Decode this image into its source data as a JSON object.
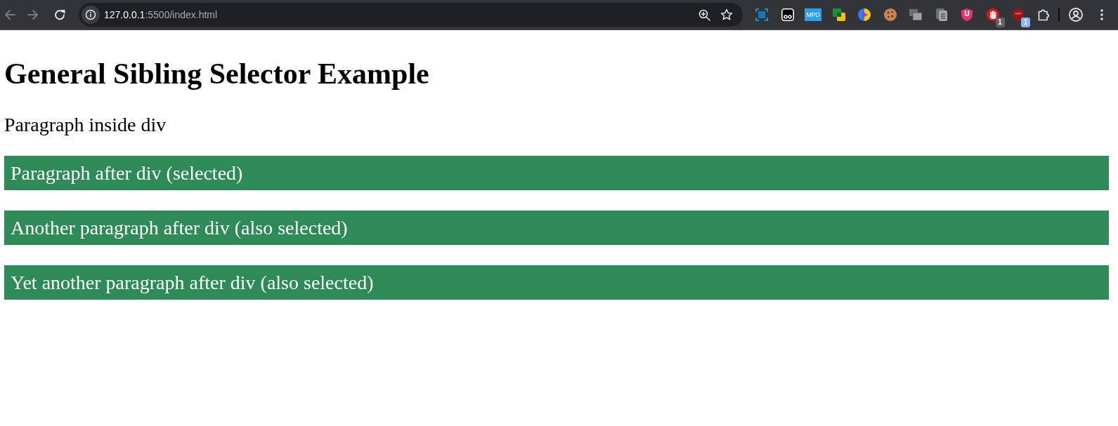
{
  "browser": {
    "nav": [
      {
        "kind": "back",
        "disabled": true
      },
      {
        "kind": "forward",
        "disabled": true
      },
      {
        "kind": "reload",
        "disabled": false
      }
    ],
    "address": {
      "host": "127.0.0.1",
      "path": ":5500/index.html"
    },
    "extensions": [
      {
        "kind": "capture"
      },
      {
        "kind": "ghost"
      },
      {
        "kind": "tile",
        "label": "MPD"
      },
      {
        "kind": "squares"
      },
      {
        "kind": "play"
      },
      {
        "kind": "cookie"
      },
      {
        "kind": "windows"
      },
      {
        "kind": "clipboard"
      },
      {
        "kind": "shield",
        "label": "U"
      },
      {
        "kind": "stop",
        "badge": {
          "text": "1",
          "color": "#616161"
        }
      },
      {
        "kind": "shield-dark",
        "badge": {
          "text": "1",
          "color": "#8ab4f8"
        }
      }
    ]
  },
  "page": {
    "heading": "General Sibling Selector Example",
    "paragraphs": [
      {
        "text": "Paragraph inside div",
        "highlighted": false
      },
      {
        "text": "Paragraph after div (selected)",
        "highlighted": true
      },
      {
        "text": "Another paragraph after div (also selected)",
        "highlighted": true
      },
      {
        "text": "Yet another paragraph after div (also selected)",
        "highlighted": true
      }
    ]
  }
}
